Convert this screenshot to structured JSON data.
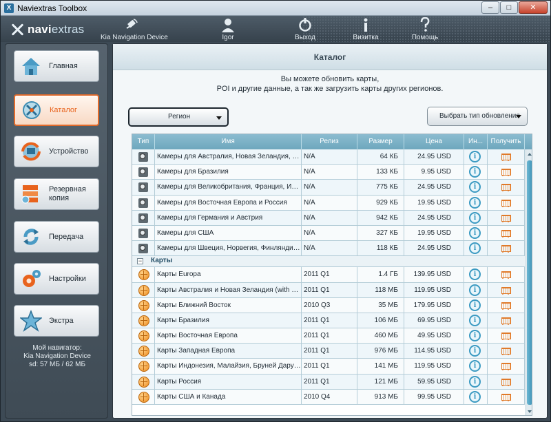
{
  "window": {
    "title": "Naviextras Toolbox",
    "btn_min": "–",
    "btn_max": "□",
    "btn_close": "✕"
  },
  "header": {
    "logo_a": "navi",
    "logo_b": "extras",
    "items": [
      {
        "label": "Kia Navigation Device",
        "icon": "satellite-icon"
      },
      {
        "label": "Igor",
        "icon": "user-icon"
      },
      {
        "label": "Выход",
        "icon": "power-icon"
      },
      {
        "label": "Визитка",
        "icon": "info-icon"
      },
      {
        "label": "Помощь",
        "icon": "help-icon"
      }
    ]
  },
  "sidebar": {
    "items": [
      {
        "label": "Главная",
        "icon": "home-icon"
      },
      {
        "label": "Каталог",
        "icon": "compass-icon",
        "active": true
      },
      {
        "label": "Устройство",
        "icon": "device-sync-icon"
      },
      {
        "label": "Резервная копия",
        "icon": "backup-icon"
      },
      {
        "label": "Передача",
        "icon": "transfer-icon"
      },
      {
        "label": "Настройки",
        "icon": "gear-icon"
      },
      {
        "label": "Экстра",
        "icon": "star-icon"
      }
    ],
    "device_info": {
      "line1": "Мой навигатор:",
      "line2": "Kia Navigation Device",
      "line3": "sd: 57 МБ / 62 МБ"
    }
  },
  "main": {
    "title": "Каталог",
    "desc1": "Вы можете обновить карты,",
    "desc2": "POI и другие данные, а так же загрузить карты других регионов.",
    "region_label": "Регион",
    "update_type_label": "Выбрать тип обновления",
    "columns": [
      "Тип",
      "Имя",
      "Релиз",
      "Размер",
      "Цена",
      "Ин...",
      "Получить"
    ],
    "group_label": "Карты",
    "cameras": [
      {
        "name": "Камеры для Австралия, Новая Зеландия, Гонк...",
        "release": "N/A",
        "size": "64 КБ",
        "price": "24.95 USD"
      },
      {
        "name": "Камеры для Бразилия",
        "release": "N/A",
        "size": "133 КБ",
        "price": "9.95 USD"
      },
      {
        "name": "Камеры для Великобритания, Франция, Итали...",
        "release": "N/A",
        "size": "775 КБ",
        "price": "24.95 USD"
      },
      {
        "name": "Камеры для Восточная Европа и Россия",
        "release": "N/A",
        "size": "929 КБ",
        "price": "19.95 USD"
      },
      {
        "name": "Камеры для Германия и Австрия",
        "release": "N/A",
        "size": "942 КБ",
        "price": "24.95 USD"
      },
      {
        "name": "Камеры для США",
        "release": "N/A",
        "size": "327 КБ",
        "price": "19.95 USD"
      },
      {
        "name": "Камеры для Швеция, Норвегия, Финляндия и ...",
        "release": "N/A",
        "size": "118 КБ",
        "price": "24.95 USD"
      }
    ],
    "maps": [
      {
        "name": "Карты Europa",
        "release": "2011 Q1",
        "size": "1.4 ГБ",
        "price": "139.95 USD"
      },
      {
        "name": "Карты Австралия и Новая Зеландия (with 4WD...",
        "release": "2011 Q1",
        "size": "118 МБ",
        "price": "119.95 USD"
      },
      {
        "name": "Карты Ближний Восток",
        "release": "2010 Q3",
        "size": "35 МБ",
        "price": "179.95 USD"
      },
      {
        "name": "Карты Бразилия",
        "release": "2011 Q1",
        "size": "106 МБ",
        "price": "69.95 USD"
      },
      {
        "name": "Карты Восточная Европа",
        "release": "2011 Q1",
        "size": "460 МБ",
        "price": "49.95 USD"
      },
      {
        "name": "Карты Западная Европа",
        "release": "2011 Q1",
        "size": "976 МБ",
        "price": "114.95 USD"
      },
      {
        "name": "Карты Индонезия, Малайзия, Бруней Даруссала...",
        "release": "2011 Q1",
        "size": "141 МБ",
        "price": "119.95 USD"
      },
      {
        "name": "Карты Россия",
        "release": "2011 Q1",
        "size": "121 МБ",
        "price": "59.95 USD"
      },
      {
        "name": "Карты США и Канада",
        "release": "2010 Q4",
        "size": "913 МБ",
        "price": "99.95 USD"
      }
    ],
    "info_glyph": "i"
  }
}
